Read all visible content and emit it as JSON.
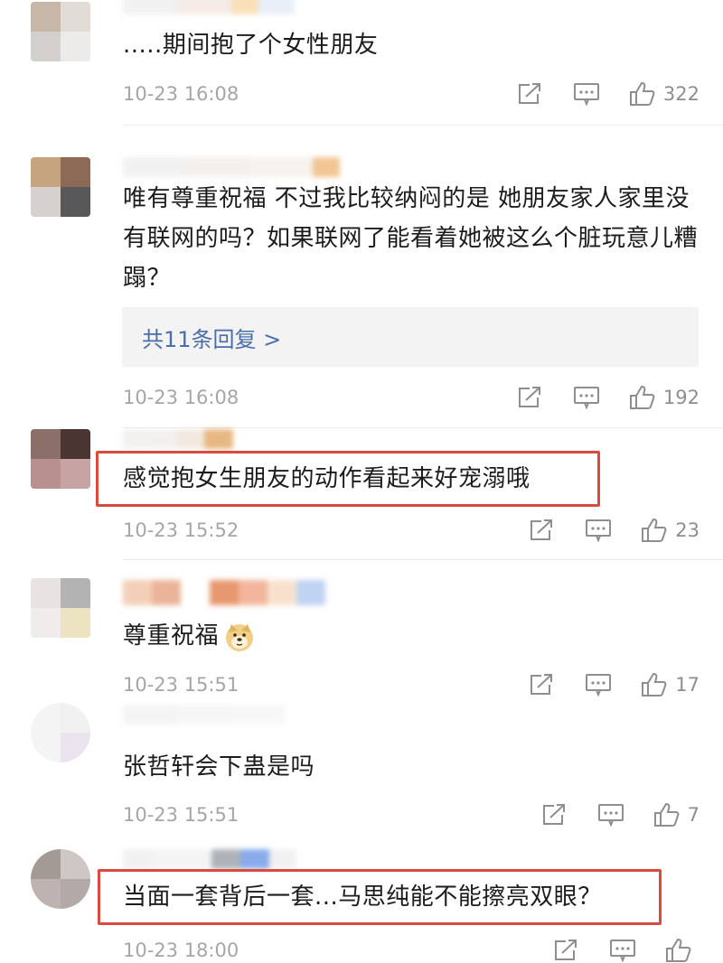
{
  "comments": [
    {
      "text": ".....期间抱了个女性朋友",
      "time": "10-23 16:08",
      "likes": "322",
      "avatar_colors": [
        "#c6b7a8",
        "#e2dcd7",
        "#d4d0ce",
        "#ecebea"
      ],
      "name_colors": [
        "#f0eeee",
        "#f3e7e2",
        "#f8d9a8",
        "#e3ecf7"
      ]
    },
    {
      "text": "唯有尊重祝福 不过我比较纳闷的是 她朋友家人家里没有联网的吗？如果联网了能看着她被这么个脏玩意儿糟蹋？",
      "reply_count_label": "共11条回复 >",
      "time": "10-23 16:08",
      "likes": "192",
      "avatar_colors": [
        "#c7a480",
        "#8d6a56",
        "#d6d1cf",
        "#585858"
      ],
      "name_colors": [
        "#eeeeee",
        "#f3ece8",
        "#f6efe9",
        "#eeb87a"
      ]
    },
    {
      "text": "感觉抱女生朋友的动作看起来好宠溺哦",
      "time": "10-23 15:52",
      "likes": "23",
      "avatar_colors": [
        "#8d6f6a",
        "#4b3533",
        "#b99090",
        "#c7a3a4"
      ],
      "name_colors": [
        "#f1eded",
        "#f0ecec",
        "#f2e4d9",
        "#e1a663"
      ]
    },
    {
      "text": "尊重祝福",
      "time": "10-23 15:51",
      "likes": "17",
      "avatar_colors": [
        "#e8e2e2",
        "#b3b3b3",
        "#f0ecec",
        "#ece4c0"
      ],
      "name_colors": [
        "#f1c4a7",
        "#e6a27f",
        "#ffffff",
        "#e07f4c",
        "#f0a484",
        "#f5dcc0",
        "#b0c9ef"
      ]
    },
    {
      "text": "张哲轩会下蛊是吗",
      "time": "10-23 15:51",
      "likes": "7",
      "avatar_colors": [
        "#f4f4f4",
        "#f1f1f1",
        "#f5f4f4",
        "#ebe4ee"
      ],
      "name_colors": [
        "#f2f2f2",
        "#f5f5f5",
        "#f6f6f6"
      ]
    },
    {
      "text": "当面一套背后一套...马思纯能不能擦亮双眼？",
      "time": "10-23 18:00",
      "likes": "",
      "avatar_colors": [
        "#a39a96",
        "#cfc7c5",
        "#bfb3b1",
        "#b3aaa8"
      ],
      "name_colors": [
        "#eeeeee",
        "#f2f2f2",
        "#9aa1a8",
        "#6c97e6",
        "#eeeeee"
      ]
    }
  ],
  "colors": {
    "highlight": "#d94a3f",
    "reply_link": "#4a6ea9",
    "meta_gray": "#a6a6a6"
  },
  "icons": [
    "share-icon",
    "comment-icon",
    "thumbs-up-icon",
    "doge-emoji"
  ]
}
